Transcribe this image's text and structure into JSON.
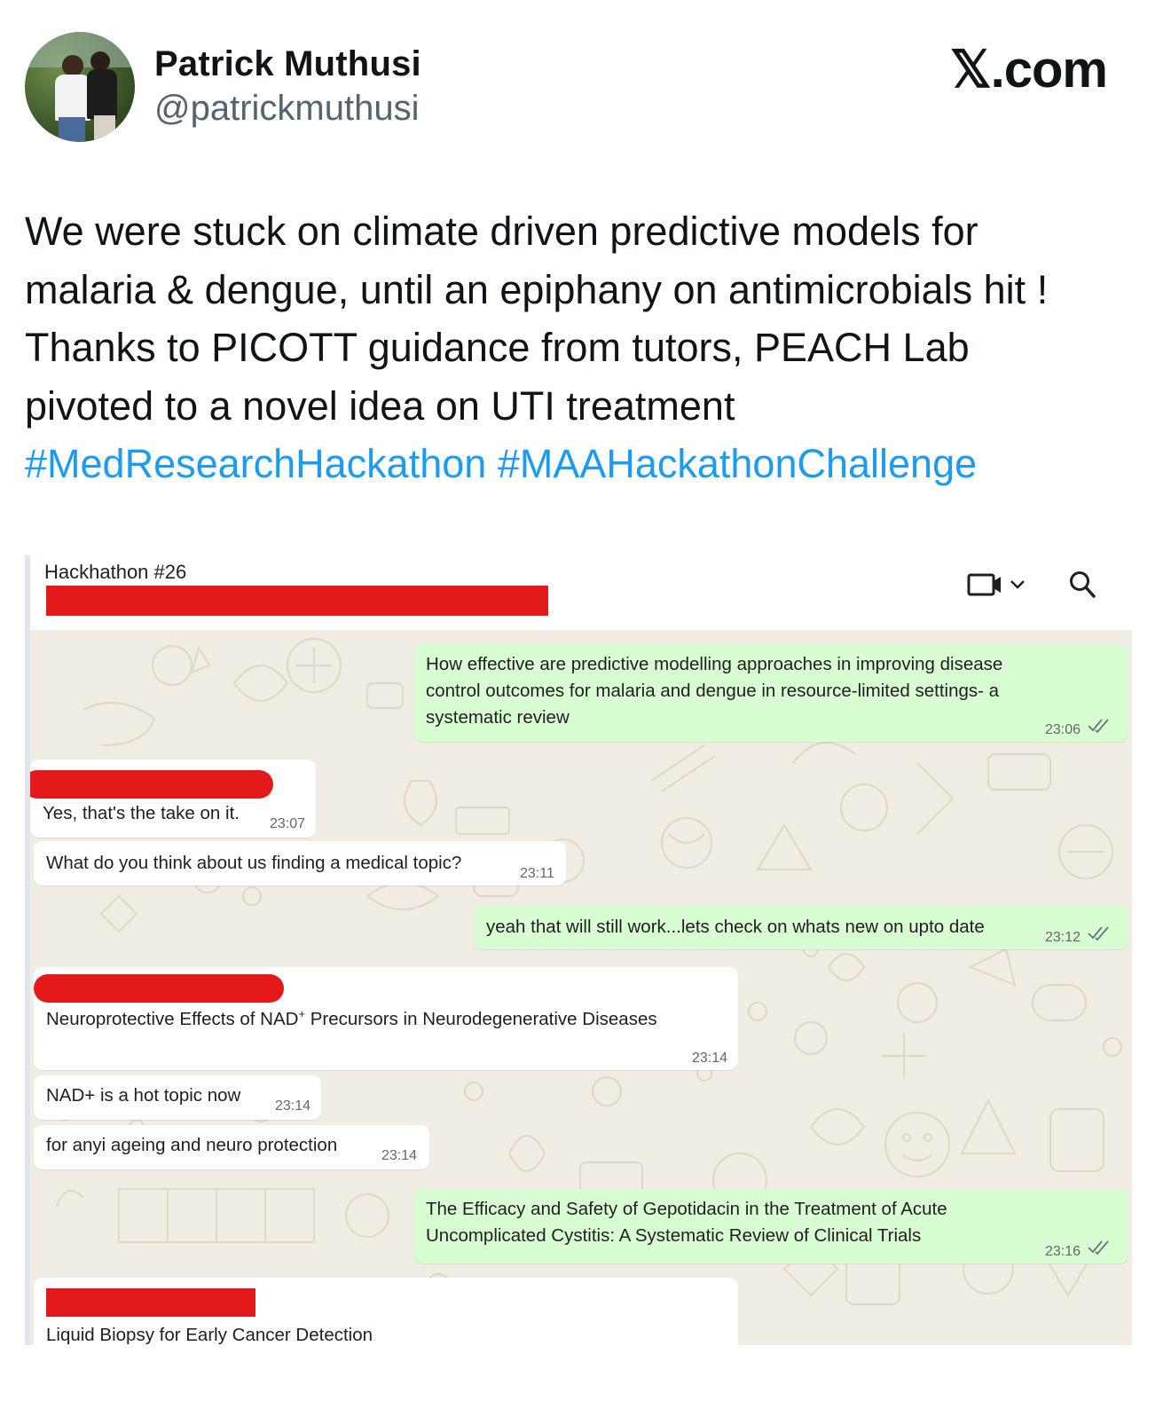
{
  "tweet": {
    "author_name": "Patrick Muthusi",
    "author_handle": "@patrickmuthusi",
    "site_logo": "𝕏.com",
    "avatar_icon": "profile-photo",
    "text_lines": [
      "We were stuck on climate driven predictive models for",
      "malaria & dengue, until an epiphany on antimicrobials hit !",
      "Thanks to PICOTT guidance from tutors, PEACH Lab",
      "pivoted to a novel idea on UTI treatment"
    ],
    "hashtags": [
      "#MedResearchHackathon",
      "#MAAHackathonChallenge"
    ],
    "hashtag_color": "#1d9bf0"
  },
  "chat": {
    "title": "Hackhathon #26",
    "icons": [
      "video-call-icon",
      "chevron-down-icon",
      "search-icon"
    ],
    "colors": {
      "outgoing_bubble": "#d9fdd3",
      "incoming_bubble": "#ffffff",
      "background": "#f1ece4",
      "redaction": "#e3191b"
    },
    "messages": [
      {
        "direction": "outgoing",
        "lines": [
          "How effective are predictive modelling approaches in improving disease",
          "control outcomes for malaria and dengue in resource-limited settings- a",
          "systematic review"
        ],
        "time": "23:06",
        "read": true
      },
      {
        "direction": "incoming",
        "sender_redacted": true,
        "text": "Yes, that's the take on it.",
        "time": "23:07"
      },
      {
        "direction": "incoming",
        "text": "What do you think about us finding a medical topic?",
        "time": "23:11"
      },
      {
        "direction": "outgoing",
        "text": "yeah that will still work...lets check on whats new on upto date",
        "time": "23:12",
        "read": true
      },
      {
        "direction": "incoming",
        "sender_redacted": true,
        "text_before": "Neuroprotective Effects of NAD",
        "text_sup": "+",
        "text_after": " Precursors in Neurodegenerative Diseases",
        "time": "23:14"
      },
      {
        "direction": "incoming",
        "text": "NAD+ is a hot topic now",
        "time": "23:14"
      },
      {
        "direction": "incoming",
        "text": "for anyi ageing and neuro protection",
        "time": "23:14"
      },
      {
        "direction": "outgoing",
        "lines": [
          "The Efficacy and Safety of Gepotidacin in the Treatment of Acute",
          "Uncomplicated Cystitis: A Systematic Review of Clinical Trials"
        ],
        "time": "23:16",
        "read": true
      },
      {
        "direction": "incoming",
        "sender_redacted": true,
        "text": "Liquid Biopsy for Early Cancer Detection"
      }
    ]
  }
}
